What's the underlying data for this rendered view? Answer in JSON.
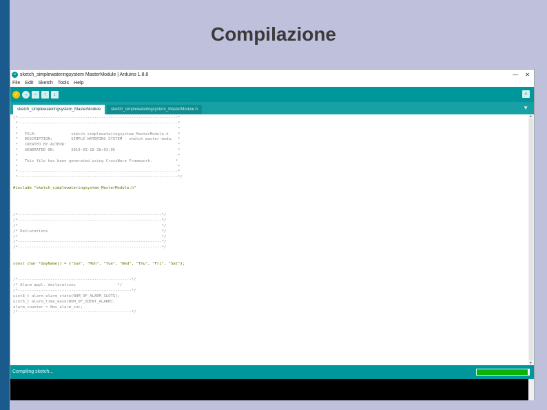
{
  "slide": {
    "title": "Compilazione"
  },
  "window": {
    "title": "sketch_simplewateringsystem MasterModule | Arduino 1.8.8",
    "controls": [
      "—",
      "✕"
    ]
  },
  "menu": [
    "File",
    "Edit",
    "Sketch",
    "Tools",
    "Help"
  ],
  "toolbar": {
    "verify_icon": "check-icon",
    "upload_icon": "arrow-right-icon",
    "serial_icon": "magnifier-icon"
  },
  "tabs": [
    "sketch_simplewateringsystem_MasterModule",
    "sketch_simplewateringsystem_MasterModule.h"
  ],
  "code_lines": [
    "/*---------------------------------------------------------------------*",
    " *---------------------------------------------------------------------*",
    " *                                                                     *",
    " *   FILE:               sketch_simplewateringsystem_MasterModule.h    *",
    " *   DESCRIPTION:        SIMPLE WATERING SYSTEM - sketch master-modu.  *",
    " *   CREATED BY AUTHOR:                                                *",
    " *   GENERATED ON:       2019-03-18 18:03:05                           *",
    " *                                                                     *",
    " *   This file has been generated using CrossWare Framework.          *",
    " *                                                                     *",
    " *---------------------------------------------------------------------*",
    " *---------------------------------------------------------------------*/",
    "",
    "#include \"sketch_simplewateringsystem_MasterModule.h\"",
    "",
    "",
    "",
    "",
    "/*--------------------------------------------------------------*/",
    "/*--------------------------------------------------------------*/",
    "/*                                                              */",
    "/* Declarations                                                 */",
    "/*                                                              */",
    "/*--------------------------------------------------------------*/",
    "/*--------------------------------------------------------------*/",
    "",
    "",
    "const char *dayName[] = {\"Sun\", \"Mon\", \"Tue\", \"Wed\", \"Thu\", \"Fri\", \"Sat\"};",
    "",
    "",
    "/*-------------------------------------------------*/",
    "/* Alarm appl. declarations                  */",
    "/*-------------------------------------------------*/",
    "uint8_t alarm_alarm_state[NUM_OF_ALARM_SLOTS];",
    "uint8_t alarm_time_mask[NUM_OF_IDENT_ALARM];",
    "alarm_counter = 0ms_alarm_cnt;",
    "/*-------------------------------------------------*/"
  ],
  "status": {
    "text": "Compiling sketch...",
    "progress_pct": 98
  }
}
